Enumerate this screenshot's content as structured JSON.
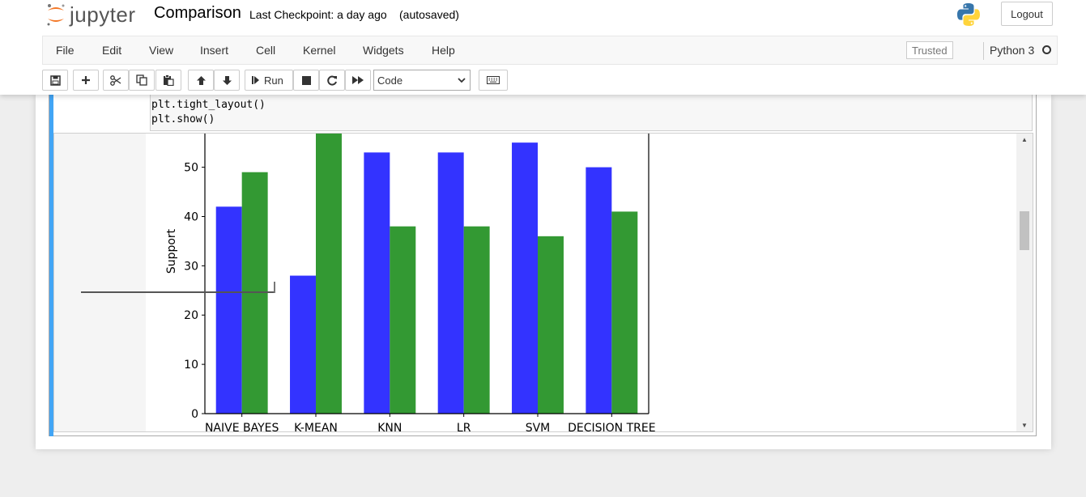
{
  "header": {
    "logo_text": "jupyter",
    "notebook_title": "Comparison",
    "checkpoint": "Last Checkpoint: a day ago",
    "autosaved": "(autosaved)",
    "logout_label": "Logout"
  },
  "menubar": {
    "items": [
      "File",
      "Edit",
      "View",
      "Insert",
      "Cell",
      "Kernel",
      "Widgets",
      "Help"
    ],
    "trusted_label": "Trusted",
    "kernel_name": "Python 3"
  },
  "toolbar": {
    "run_label": "Run",
    "cell_type": "Code",
    "icons": [
      "save-icon",
      "plus-icon",
      "cut-icon",
      "copy-icon",
      "paste-icon",
      "arrow-up-icon",
      "arrow-down-icon",
      "run-icon",
      "stop-icon",
      "restart-icon",
      "fast-forward-icon",
      "keyboard-icon"
    ]
  },
  "cell": {
    "code_lines": [
      "plt.tight_layout()",
      "plt.show()"
    ]
  },
  "colors": {
    "accent_blue": "#42a5f5",
    "series1": "#3333ff",
    "series2": "#339933"
  },
  "chart_data": {
    "type": "bar",
    "categories": [
      "NAIVE BAYES",
      "K-MEAN",
      "KNN",
      "LR",
      "SVM",
      "DECISION TREE"
    ],
    "series": [
      {
        "values": [
          42,
          28,
          53,
          53,
          55,
          50
        ]
      },
      {
        "values": [
          49,
          57,
          38,
          38,
          36,
          41
        ]
      }
    ],
    "ylabel": "Support",
    "yticks": [
      0,
      10,
      20,
      30,
      40,
      50
    ],
    "ylim": [
      0,
      57
    ],
    "grid": false
  }
}
